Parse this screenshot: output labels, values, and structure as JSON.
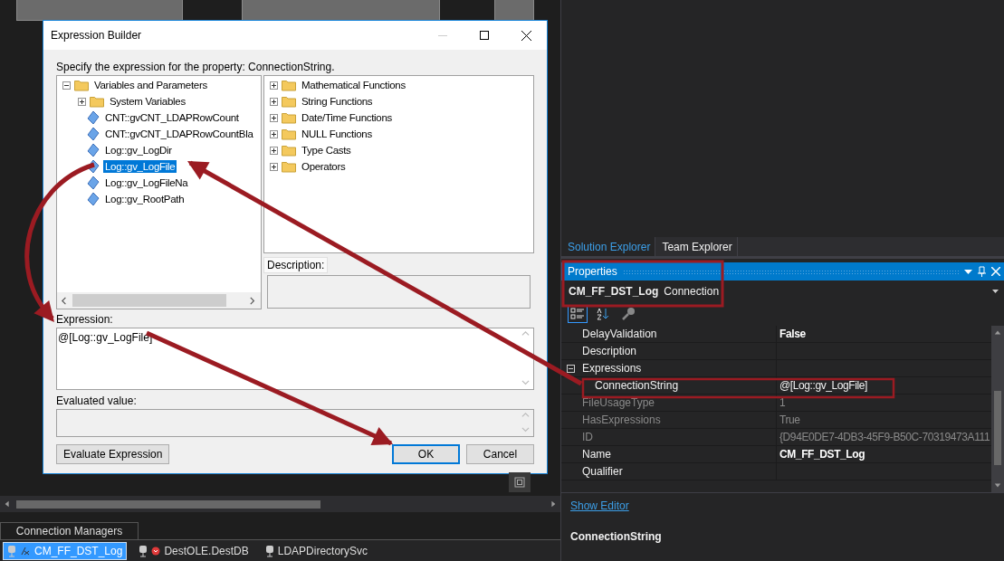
{
  "dialog": {
    "title": "Expression Builder",
    "prompt": "Specify the expression for the property: ConnectionString.",
    "variables_tree": [
      {
        "label": "Variables and Parameters",
        "kind": "folder",
        "expanded": true,
        "selected": false,
        "children": [
          {
            "label": "System Variables",
            "kind": "folder",
            "expanded": false,
            "selected": false
          },
          {
            "label": "CNT::gvCNT_LDAPRowCount",
            "kind": "variable",
            "selected": false
          },
          {
            "label": "CNT::gvCNT_LDAPRowCountBla",
            "kind": "variable",
            "selected": false
          },
          {
            "label": "Log::gv_LogDir",
            "kind": "variable",
            "selected": false
          },
          {
            "label": "Log::gv_LogFile",
            "kind": "variable",
            "selected": true
          },
          {
            "label": "Log::gv_LogFileNa",
            "kind": "variable",
            "selected": false
          },
          {
            "label": "Log::gv_RootPath",
            "kind": "variable",
            "selected": false
          }
        ]
      }
    ],
    "functions_tree": [
      {
        "label": "Mathematical Functions",
        "kind": "folder",
        "expanded": false,
        "selected": false
      },
      {
        "label": "String Functions",
        "kind": "folder",
        "expanded": false,
        "selected": false
      },
      {
        "label": "Date/Time Functions",
        "kind": "folder",
        "expanded": false,
        "selected": false
      },
      {
        "label": "NULL Functions",
        "kind": "folder",
        "expanded": false,
        "selected": false
      },
      {
        "label": "Type Casts",
        "kind": "folder",
        "expanded": false,
        "selected": false
      },
      {
        "label": "Operators",
        "kind": "folder",
        "expanded": false,
        "selected": false
      }
    ],
    "description_label": "Description:",
    "expression_label": "Expression:",
    "expression": "@[Log::gv_LogFile]",
    "evaluated_label": "Evaluated value:",
    "buttons": [
      {
        "label": "Evaluate Expression",
        "default": false
      },
      {
        "label": "OK",
        "default": true
      },
      {
        "label": "Cancel",
        "default": false
      }
    ]
  },
  "connection_managers": {
    "tab": "Connection Managers",
    "items": [
      {
        "label": "CM_FF_DST_Log",
        "selected": true,
        "kind": "expression"
      },
      {
        "label": "DestOLE.DestDB",
        "selected": false,
        "kind": "error"
      },
      {
        "label": "LDAPDirectorySvc",
        "selected": false,
        "kind": "plain"
      }
    ]
  },
  "side_tabs": [
    {
      "label": "Solution Explorer",
      "selected": true
    },
    {
      "label": "Team Explorer",
      "selected": false
    }
  ],
  "properties": {
    "title": "Properties",
    "object_name": "CM_FF_DST_Log",
    "object_type": "Connection",
    "rows": [
      {
        "kind": "property",
        "name": "DelayValidation",
        "value": "False",
        "modified": true,
        "readonly": false
      },
      {
        "kind": "property",
        "name": "Description",
        "readonly": false
      },
      {
        "kind": "category",
        "name": "Expressions",
        "expanded": true,
        "children": [
          {
            "kind": "property",
            "name": "ConnectionString",
            "value": "@[Log::gv_LogFile]",
            "modified": false,
            "readonly": false
          }
        ]
      },
      {
        "kind": "property",
        "name": "FileUsageType",
        "value": "1",
        "modified": false,
        "readonly": true
      },
      {
        "kind": "property",
        "name": "HasExpressions",
        "value": "True",
        "modified": false,
        "readonly": true
      },
      {
        "kind": "property",
        "name": "ID",
        "value": "{D94E0DE7-4DB3-45F9-B50C-70319473A111",
        "modified": false,
        "readonly": true
      },
      {
        "kind": "property",
        "name": "Name",
        "value": "CM_FF_DST_Log",
        "modified": true,
        "readonly": false
      },
      {
        "kind": "property",
        "name": "Qualifier",
        "readonly": false
      }
    ],
    "link": "Show Editor",
    "description_title": "ConnectionString"
  }
}
